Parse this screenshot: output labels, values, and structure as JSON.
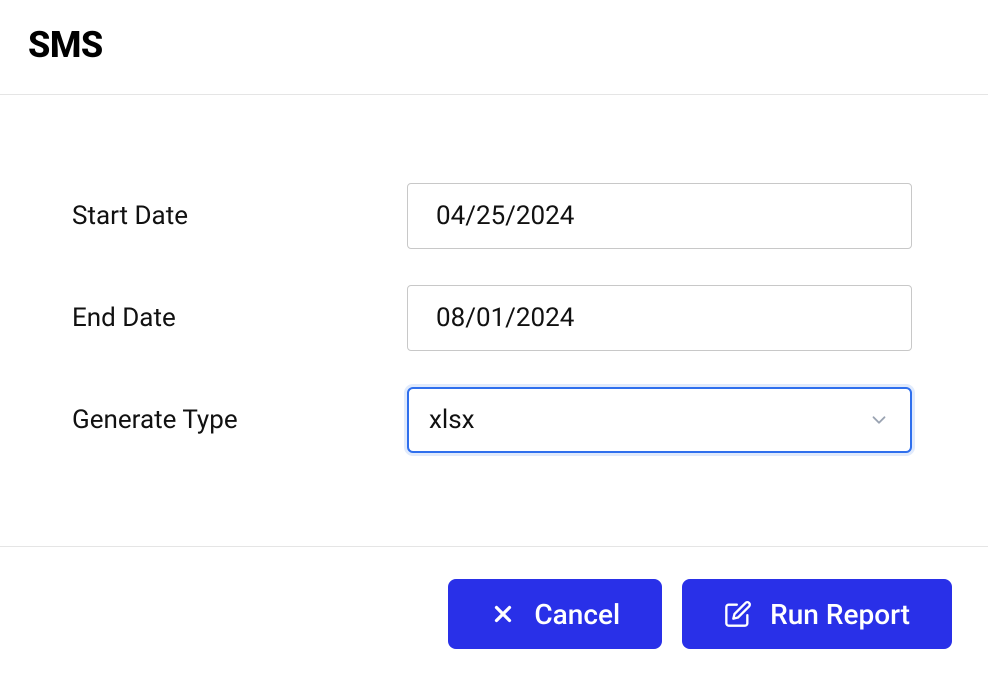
{
  "header": {
    "title": "SMS"
  },
  "form": {
    "start_date": {
      "label": "Start Date",
      "value": "04/25/2024"
    },
    "end_date": {
      "label": "End Date",
      "value": "08/01/2024"
    },
    "generate_type": {
      "label": "Generate Type",
      "value": "xlsx"
    }
  },
  "footer": {
    "cancel_label": "Cancel",
    "run_label": "Run Report"
  }
}
